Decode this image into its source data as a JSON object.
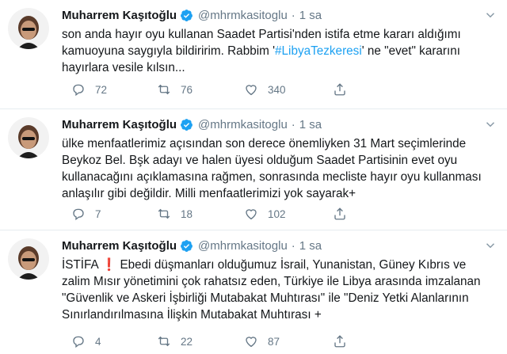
{
  "colors": {
    "link": "#1da1f2",
    "muted": "#657786",
    "divider": "#e6ecf0",
    "exclaim_red": "#e0245e"
  },
  "icons": [
    "avatar",
    "verified-badge-icon",
    "caret-down-icon",
    "reply-icon",
    "retweet-icon",
    "like-icon",
    "share-icon"
  ],
  "tweets": [
    {
      "author": "Muharrem Kaşıtoğlu",
      "handle": "@mhrmkasitoglu",
      "separator": "·",
      "time": "1 sa",
      "lines": {
        "l1": "son anda hayır oyu kullanan Saadet Partisi'nden istifa etme kararı aldığımı",
        "l2": "kamuoyuna saygıyla bildiririm. Rabbim '",
        "l2_hashtag": "#LibyaTezkeresi",
        "l2_after": "' ne \"evet\" kararını",
        "l3": "hayırlara vesile kılsın..."
      },
      "replies": "72",
      "retweets": "76",
      "likes": "340"
    },
    {
      "author": "Muharrem Kaşıtoğlu",
      "handle": "@mhrmkasitoglu",
      "separator": "·",
      "time": "1 sa",
      "lines": {
        "l1": "ülke menfaatlerimiz açısından son derece önemliyken 31 Mart seçimlerinde",
        "l2": "Beykoz Bel. Bşk adayı ve halen üyesi olduğum Saadet Partisinin evet oyu",
        "l3": "kullanacağını açıklamasına rağmen, sonrasında mecliste hayır oyu kullanması",
        "l4": "anlaşılır gibi değildir. Milli menfaatlerimizi yok sayarak+"
      },
      "replies": "7",
      "retweets": "18",
      "likes": "102"
    },
    {
      "author": "Muharrem Kaşıtoğlu",
      "handle": "@mhrmkasitoglu",
      "separator": "·",
      "time": "1 sa",
      "lines": {
        "l1_prefix": "İSTİFA ",
        "l1_emoji": "❗",
        "l1": " Ebedi düşmanları olduğumuz İsrail, Yunanistan, Güney Kıbrıs ve",
        "l2": "zalim Mısır yönetimini çok rahatsız eden, Türkiye ile Libya arasında imzalanan",
        "l3": "\"Güvenlik ve Askeri İşbirliği Mutabakat Muhtırası\" ile \"Deniz Yetki Alanlarının",
        "l4": "Sınırlandırılmasına İlişkin Mutabakat Muhtırası +"
      },
      "replies": "4",
      "retweets": "22",
      "likes": "87"
    }
  ]
}
